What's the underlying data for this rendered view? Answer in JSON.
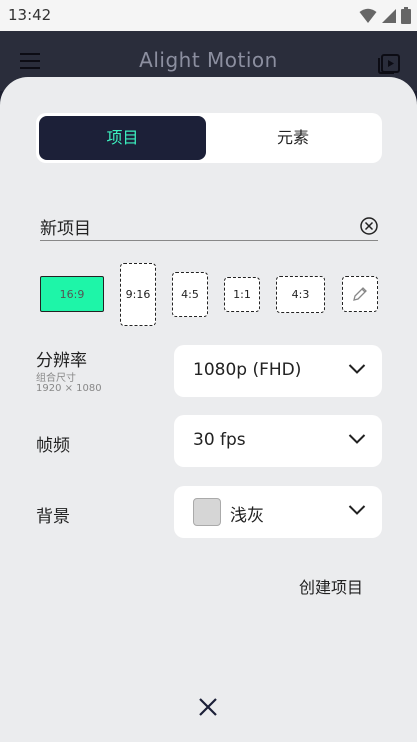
{
  "status_bar": {
    "time": "13:42"
  },
  "app_bar": {
    "title": "Alight Motion"
  },
  "tabs": [
    {
      "label": "项目"
    },
    {
      "label": "元素"
    }
  ],
  "project_name": {
    "value": "新项目"
  },
  "aspect_ratios": [
    {
      "label": "16:9",
      "selected": true
    },
    {
      "label": "9:16"
    },
    {
      "label": "4:5"
    },
    {
      "label": "1:1"
    },
    {
      "label": "4:3"
    },
    {
      "label": "",
      "icon": "pencil-icon"
    }
  ],
  "resolution": {
    "label": "分辨率",
    "sub_label": "组合尺寸",
    "dimensions": "1920 × 1080",
    "value": "1080p (FHD)"
  },
  "frame_rate": {
    "label": "帧频",
    "value": "30 fps"
  },
  "background": {
    "label": "背景",
    "value": "浅灰",
    "swatch_color": "#d6d6d6"
  },
  "create_button": {
    "label": "创建项目"
  },
  "colors": {
    "accent": "#1ef5a8",
    "tab_text": "#3cf2c0",
    "dark": "#1c2038"
  }
}
